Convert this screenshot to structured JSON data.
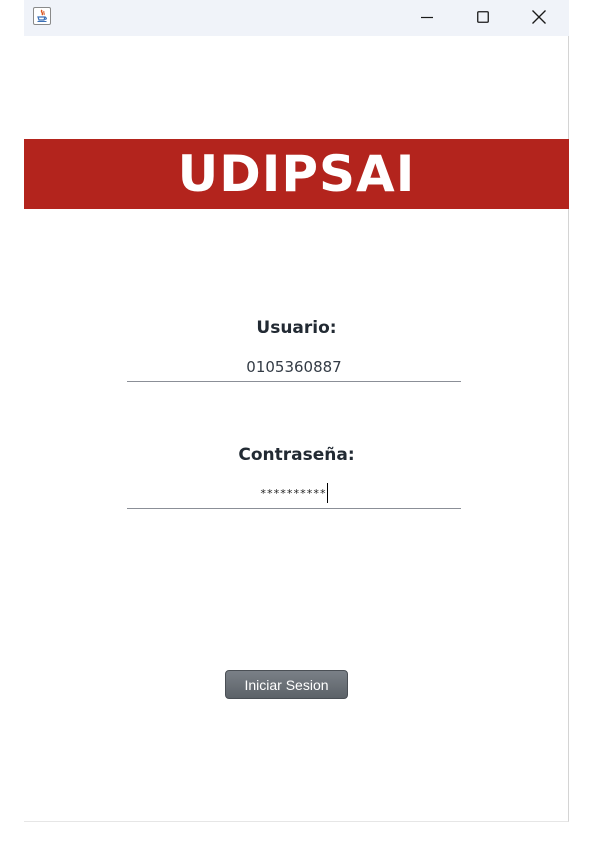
{
  "window": {
    "controls": {
      "minimize": "minimize-icon",
      "maximize": "maximize-icon",
      "close": "close-icon"
    },
    "app_icon": "java-app-icon"
  },
  "banner": {
    "title": "UDIPSAI",
    "color": "#b3241d"
  },
  "form": {
    "user_label": "Usuario:",
    "user_value": "0105360887",
    "password_label": "Contraseña:",
    "password_value": "**********",
    "submit_label": "Iniciar Sesion"
  }
}
